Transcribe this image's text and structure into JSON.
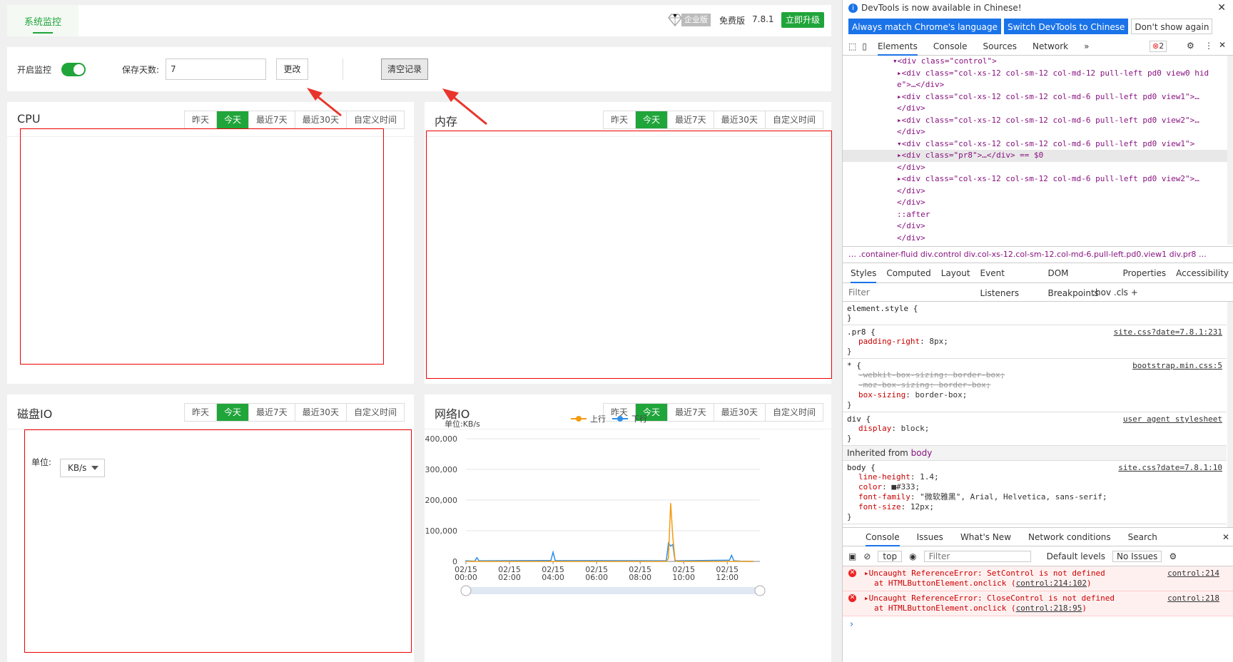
{
  "topbar": {
    "tab": "系统监控",
    "enterprise_tag": "企业版",
    "edition": "免费版",
    "version": "7.8.1",
    "upgrade": "立即升级"
  },
  "control": {
    "enable_label": "开启监控",
    "enabled": true,
    "days_label": "保存天数:",
    "days_value": "7",
    "change_btn": "更改",
    "clear_btn": "清空记录"
  },
  "ranges": [
    "昨天",
    "今天",
    "最近7天",
    "最近30天",
    "自定义时间"
  ],
  "active_range": "今天",
  "panels": {
    "cpu": "CPU",
    "mem": "内存",
    "disk": "磁盘IO",
    "net": "网络IO"
  },
  "disk": {
    "unit_label": "单位:",
    "unit_value": "KB/s"
  },
  "colors": {
    "accent": "#20a53a",
    "upload": "#f39c12",
    "download": "#2f8ee8",
    "annotation": "#e00000"
  },
  "chart_data": {
    "type": "line",
    "ylabel": "单位:KB/s",
    "ylim": [
      0,
      400000
    ],
    "yticks": [
      "400,000",
      "300,000",
      "200,000",
      "100,000",
      "0"
    ],
    "xticks": [
      [
        "02/15",
        "00:00"
      ],
      [
        "02/15",
        "02:00"
      ],
      [
        "02/15",
        "04:00"
      ],
      [
        "02/15",
        "06:00"
      ],
      [
        "02/15",
        "08:00"
      ],
      [
        "02/15",
        "10:00"
      ],
      [
        "02/15",
        "12:00"
      ]
    ],
    "x_hours": [
      0,
      0.4,
      0.5,
      0.6,
      3.9,
      4.0,
      4.1,
      9.2,
      9.3,
      9.4,
      9.5,
      9.6,
      9.7,
      12.1,
      12.2,
      12.3,
      12.6
    ],
    "series": [
      {
        "name": "上行",
        "values": [
          0,
          0,
          0,
          0,
          0,
          0,
          0,
          0,
          10000,
          190000,
          80000,
          5000,
          0,
          0,
          0,
          0,
          0
        ]
      },
      {
        "name": "下行",
        "values": [
          2000,
          1000,
          12000,
          2000,
          3000,
          30000,
          3000,
          2000,
          60000,
          50000,
          55000,
          3000,
          2000,
          4000,
          20000,
          2000,
          1000
        ]
      }
    ]
  },
  "devtools": {
    "info": "DevTools is now available in Chinese!",
    "lang_btns": [
      "Always match Chrome's language",
      "Switch DevTools to Chinese",
      "Don't show again"
    ],
    "tabs": [
      "Elements",
      "Console",
      "Sources",
      "Network",
      "»"
    ],
    "error_count": "2",
    "tree": [
      "▾<div class=\"control\">",
      "  ▸<div class=\"col-xs-12 col-sm-12 col-md-12 pull-left pd0 view0 hid",
      "   e\">…</div>",
      "  ▸<div class=\"col-xs-12 col-sm-12 col-md-6 pull-left pd0 view1\">…",
      "   </div>",
      "  ▸<div class=\"col-xs-12 col-sm-12 col-md-6 pull-left pd0 view2\">…",
      "   </div>",
      "  ▾<div class=\"col-xs-12 col-sm-12 col-md-6 pull-left pd0 view1\">",
      "    ▸<div class=\"pr8\">…</div> == $0",
      "   </div>",
      "  ▸<div class=\"col-xs-12 col-sm-12 col-md-6 pull-left pd0 view2\">…",
      "   </div>",
      " </div>",
      " ::after",
      "</div>",
      "</div>"
    ],
    "breadcrumb": "…  .container-fluid   div.control   div.col-xs-12.col-sm-12.col-md-6.pull-left.pd0.view1   div.pr8   …",
    "subtabs": [
      "Styles",
      "Computed",
      "Layout",
      "Event Listeners",
      "DOM Breakpoints",
      "Properties",
      "Accessibility"
    ],
    "filter": "Filter",
    "filter_tools": ":hov  .cls  +",
    "rules": [
      {
        "sel": "element.style {",
        "src": "",
        "props": [],
        "strike": []
      },
      {
        "sel": ".pr8 {",
        "src": "site.css?date=7.8.1:231",
        "props": [
          "padding-right: 8px;"
        ],
        "strike": []
      },
      {
        "sel": "* {",
        "src": "bootstrap.min.css:5",
        "props": [
          "box-sizing: border-box;"
        ],
        "strike": [
          "-webkit-box-sizing: border-box;",
          "-moz-box-sizing: border-box;"
        ]
      },
      {
        "sel": "div {",
        "src": "user agent stylesheet",
        "props": [
          "display: block;"
        ],
        "strike": []
      }
    ],
    "inherited_label": "Inherited from",
    "inherited_from": "body",
    "body_rule": {
      "sel": "body {",
      "src": "site.css?date=7.8.1:10",
      "props": [
        "line-height: 1.4;",
        "color: ■#333;",
        "font-family: \"微软雅黑\", Arial, Helvetica, sans-serif;",
        "font-size: 12px;"
      ]
    },
    "console_tabs": [
      "Console",
      "Issues",
      "What's New",
      "Network conditions",
      "Search"
    ],
    "console_toolbar": {
      "context": "top",
      "filter": "Filter",
      "levels": "Default levels",
      "issues": "No Issues"
    },
    "errors": [
      {
        "msg": "▸Uncaught ReferenceError: SetControl is not defined",
        "at": "at HTMLButtonElement.onclick (",
        "loc": "control:214:102",
        "link": "control:214"
      },
      {
        "msg": "▸Uncaught ReferenceError: CloseControl is not defined",
        "at": "at HTMLButtonElement.onclick (",
        "loc": "control:218:95",
        "link": "control:218"
      }
    ],
    "prompt": "›"
  }
}
